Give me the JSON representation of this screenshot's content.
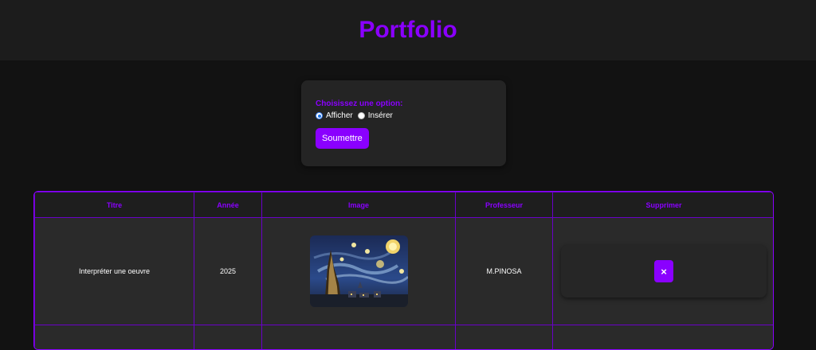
{
  "header": {
    "title": "Portfolio"
  },
  "form": {
    "label": "Choisissez une option:",
    "options": [
      {
        "label": "Afficher",
        "checked": true
      },
      {
        "label": "Insérer",
        "checked": false
      }
    ],
    "submit_label": "Soumettre"
  },
  "table": {
    "headers": [
      "Titre",
      "Année",
      "Image",
      "Professeur",
      "Supprimer"
    ],
    "rows": [
      {
        "titre": "Interpréter une oeuvre",
        "annee": "2025",
        "image_icon": "starry-night-painting-image",
        "professeur": "M.PINOSA",
        "delete_label": "×"
      }
    ]
  },
  "colors": {
    "accent": "#8a00ff",
    "background": "#121212",
    "header_bg": "#1c1c1c",
    "card_bg": "#242424"
  }
}
